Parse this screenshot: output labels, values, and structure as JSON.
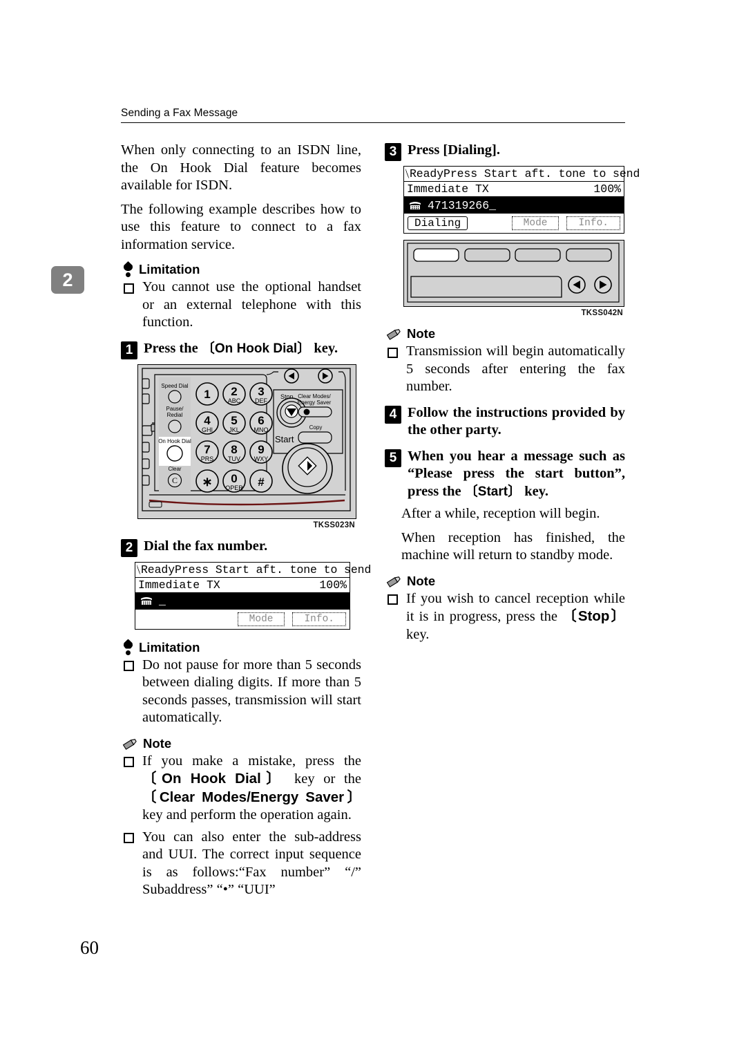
{
  "header": {
    "running_head": "Sending a Fax Message"
  },
  "chapter_tab": {
    "number": "2"
  },
  "page_number": "60",
  "left_column": {
    "intro_paragraphs": [
      "When only connecting to an ISDN line, the On Hook Dial feature becomes available for ISDN.",
      "The following example describes how to use this feature to connect to a fax information service."
    ],
    "limitation_1": {
      "label": "Limitation",
      "items": [
        "You cannot use the optional handset or an external telephone with this function."
      ]
    },
    "step1": {
      "num": "1",
      "text_before": "Press the ",
      "keycap": "On Hook Dial",
      "text_after": " key."
    },
    "figure1": {
      "caption": "TKSS023N"
    },
    "step2": {
      "num": "2",
      "text": "Dial the fax number."
    },
    "lcd1": {
      "status": "Ready",
      "prompt": "Press Start aft. tone to send",
      "mode": "Immediate TX",
      "zoom": "100%",
      "entry": "_",
      "softkey_mode": "Mode",
      "softkey_info": "Info."
    },
    "limitation_2": {
      "label": "Limitation",
      "items": [
        "Do not pause for more than 5 seconds between dialing digits. If more than 5 seconds passes, transmission will start automatically."
      ]
    },
    "note_1": {
      "label": "Note",
      "item1_a": "If you make a mistake, press the ",
      "item1_key1": "On Hook Dial",
      "item1_b": " key or the ",
      "item1_key2": "Clear Modes/Energy Saver",
      "item1_c": " key and perform the operation again.",
      "item2": "You can also enter the sub-address and UUI. The correct input sequence is as follows:“Fax number” “/” Subaddress” “•” “UUI”"
    }
  },
  "right_column": {
    "step3": {
      "num": "3",
      "text": "Press [Dialing]."
    },
    "lcd2": {
      "status": "Ready",
      "prompt": "Press Start aft. tone to send",
      "mode": "Immediate TX",
      "zoom": "100%",
      "entry": "471319266_",
      "softkey_dialing": "Dialing",
      "softkey_mode": "Mode",
      "softkey_info": "Info."
    },
    "figure2": {
      "caption": "TKSS042N"
    },
    "note_2": {
      "label": "Note",
      "items": [
        "Transmission will begin automatically 5 seconds after entering the fax number."
      ]
    },
    "step4": {
      "num": "4",
      "text": "Follow the instructions provided by the other party."
    },
    "step5": {
      "num": "5",
      "text_a": "When you hear a message such as “Please press the start button”, press the ",
      "keycap": "Start",
      "text_b": " key."
    },
    "paragraphs": [
      "After a while, reception will begin.",
      "When reception has finished, the machine will return to standby mode."
    ],
    "note_3": {
      "label": "Note",
      "item_a": "If you wish to cancel reception while it is in progress, press the ",
      "item_key": "Stop",
      "item_b": " key."
    }
  },
  "operator_panel_keys": {
    "speed_dial": "Speed Dial",
    "pause_redial": "Pause/\nRedial",
    "on_hook_dial": "On Hook Dial",
    "clear": "Clear",
    "clear_c": "C",
    "stop": "Stop",
    "start": "Start",
    "copy": "Copy",
    "clear_modes": "Clear Modes/\nEnergy Saver",
    "keypad": [
      {
        "d": "1",
        "s": ""
      },
      {
        "d": "2",
        "s": "ABC"
      },
      {
        "d": "3",
        "s": "DEF"
      },
      {
        "d": "4",
        "s": "GHI"
      },
      {
        "d": "5",
        "s": "JKL"
      },
      {
        "d": "6",
        "s": "MNO"
      },
      {
        "d": "7",
        "s": "PRS"
      },
      {
        "d": "8",
        "s": "TUV"
      },
      {
        "d": "9",
        "s": "WXY"
      },
      {
        "d": "∗",
        "s": ""
      },
      {
        "d": "0",
        "s": "OPER"
      },
      {
        "d": "#",
        "s": ""
      }
    ]
  },
  "colors": {
    "panel_gray": "#d2d2d2",
    "tab_gray": "#808080",
    "ink": "#000000"
  }
}
